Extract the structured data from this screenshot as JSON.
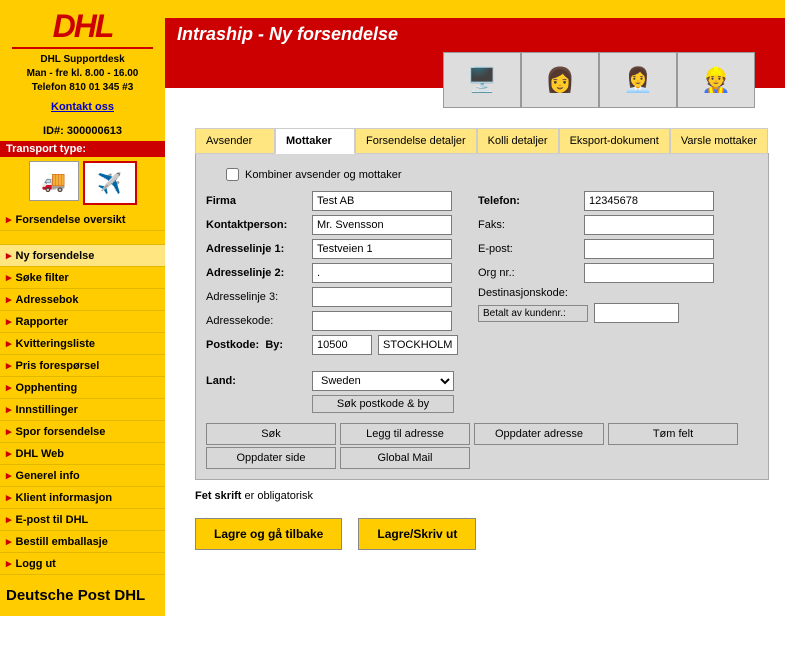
{
  "logo": "DHL",
  "support": {
    "line1": "DHL Supportdesk",
    "line2": "Man - fre kl. 8.00 - 16.00",
    "line3": "Telefon 810 01 345 #3",
    "contact": "Kontakt oss"
  },
  "id_label": "ID#: 300000613",
  "transport_header": "Transport type:",
  "nav": [
    "Forsendelse oversikt",
    "Ny forsendelse",
    "Søke filter",
    "Adressebok",
    "Rapporter",
    "Kvitteringsliste",
    "Pris forespørsel",
    "Opphenting",
    "Innstillinger",
    "Spor forsendelse",
    "DHL Web",
    "Generel info",
    "Klient informasjon",
    "E-post til DHL",
    "Bestill emballasje",
    "Logg ut"
  ],
  "footer": "Deutsche Post DHL",
  "header_title": "Intraship - Ny forsendelse",
  "tabs": [
    "Avsender",
    "Mottaker",
    "Forsendelse detaljer",
    "Kolli detaljer",
    "Eksport-dokument",
    "Varsle mottaker"
  ],
  "combine_label": "Kombiner avsender og mottaker",
  "left_fields": {
    "firma": "Firma",
    "kontaktperson": "Kontaktperson:",
    "addr1": "Adresselinje 1:",
    "addr2": "Adresselinje 2:",
    "addr3": "Adresselinje 3:",
    "addrkode": "Adressekode:",
    "postkode": "Postkode:",
    "by": "By:",
    "land": "Land:"
  },
  "values": {
    "firma": "Test AB",
    "kontaktperson": "Mr. Svensson",
    "addr1": "Testveien 1",
    "addr2": ".",
    "addr3": "",
    "addrkode": "",
    "postkode": "10500",
    "by": "STOCKHOLM",
    "land": "Sweden",
    "telefon": "12345678",
    "faks": "",
    "epost": "",
    "orgnr": "",
    "betalt": ""
  },
  "right_fields": {
    "telefon": "Telefon:",
    "faks": "Faks:",
    "epost": "E-post:",
    "orgnr": "Org nr.:",
    "destkode": "Destinasjonskode:",
    "betalt": "Betalt av kundenr.:"
  },
  "buttons": {
    "sok_postkode": "Søk postkode & by",
    "sok": "Søk",
    "legg_til": "Legg til adresse",
    "oppdater_adr": "Oppdater adresse",
    "tom": "Tøm felt",
    "oppdater_side": "Oppdater side",
    "global_mail": "Global Mail",
    "lagre_tilbake": "Lagre og gå tilbake",
    "lagre_skriv": "Lagre/Skriv ut"
  },
  "note_bold": "Fet skrift",
  "note_rest": " er obligatorisk"
}
